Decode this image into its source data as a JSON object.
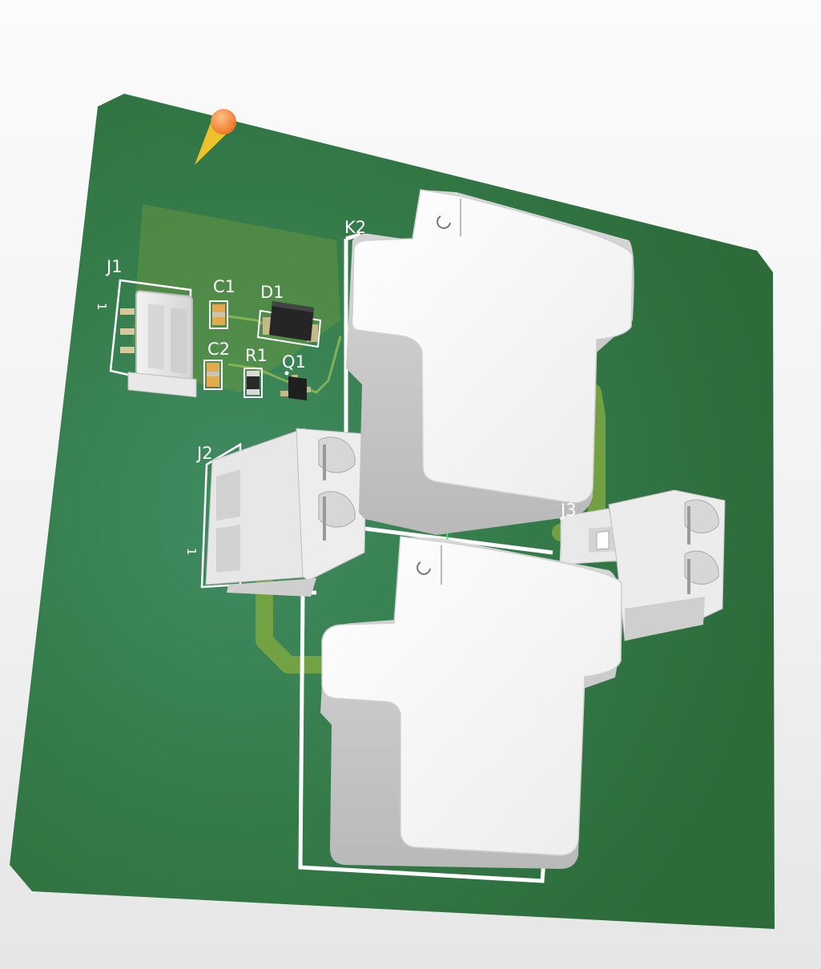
{
  "colors": {
    "board": "#2f6e3f",
    "board_light": "#3d8a5f",
    "copper_trace": "#7ba842",
    "silkscreen": "#ffffff",
    "relay_body": "#f4f4f4",
    "connector_body": "#e3e3e3",
    "marker": "#f08a2c"
  },
  "designators": {
    "k2": "K2",
    "j1": "J1",
    "j2": "J2",
    "j3": "J3",
    "c1": "C1",
    "c2": "C2",
    "d1": "D1",
    "r1": "R1",
    "q1": "Q1"
  },
  "pin1_markers": {
    "j1": "1",
    "j2": "1"
  },
  "icons": {
    "origin_marker": "cone-marker-icon"
  }
}
